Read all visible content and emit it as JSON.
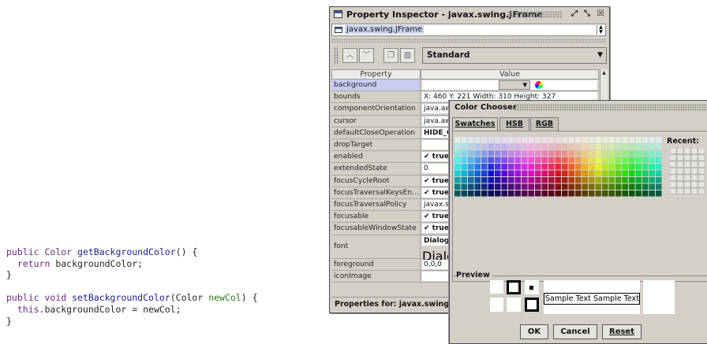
{
  "code": {
    "lines": [
      [
        {
          "t": "public ",
          "c": "kw"
        },
        {
          "t": "Color ",
          "c": "ty"
        },
        {
          "t": "getBackgroundColor",
          "c": "nm"
        },
        {
          "t": "() {",
          "c": ""
        }
      ],
      [
        {
          "t": "  return ",
          "c": "kw"
        },
        {
          "t": "backgroundColor;",
          "c": ""
        }
      ],
      [
        {
          "t": "}",
          "c": ""
        }
      ],
      [
        {
          "t": "",
          "c": ""
        }
      ],
      [
        {
          "t": "public ",
          "c": "kw"
        },
        {
          "t": "void ",
          "c": "kw"
        },
        {
          "t": "setBackgroundColor",
          "c": "nm"
        },
        {
          "t": "(Color ",
          "c": ""
        },
        {
          "t": "newCol",
          "c": "pm"
        },
        {
          "t": ") {",
          "c": ""
        }
      ],
      [
        {
          "t": "  this",
          "c": "kw"
        },
        {
          "t": ".backgroundColor = newCol;",
          "c": ""
        }
      ],
      [
        {
          "t": "}",
          "c": ""
        }
      ]
    ]
  },
  "inspector": {
    "title": "Property Inspector - javax.swing.JFrame",
    "title_buttons": [
      "⤢",
      "⤡",
      "☒"
    ],
    "class_field": "javax.swing.JFrame",
    "view_combo": "Standard",
    "col_property": "Property",
    "col_value": "Value",
    "rows": [
      {
        "name": "background",
        "value": ""
      },
      {
        "name": "bounds",
        "value": "X: 460  Y: 221  Width: 310  Height: 327"
      },
      {
        "name": "componentOrientation",
        "value": "java.aw"
      },
      {
        "name": "cursor",
        "value": "java.aw"
      },
      {
        "name": "defaultCloseOperation",
        "value": "HIDE_O"
      },
      {
        "name": "dropTarget",
        "value": ""
      },
      {
        "name": "enabled",
        "value": "✔ true"
      },
      {
        "name": "extendedState",
        "value": "0"
      },
      {
        "name": "focusCycleRoot",
        "value": "✔ true"
      },
      {
        "name": "focusTraversalKeysEn...",
        "value": "✔ true"
      },
      {
        "name": "focusTraversalPolicy",
        "value": "javax.s"
      },
      {
        "name": "focusable",
        "value": "✔ true"
      },
      {
        "name": "focusableWindowState",
        "value": "✔ true"
      },
      {
        "name": "font",
        "value": "Dialog"
      },
      {
        "name": "",
        "value": "Dialog,"
      },
      {
        "name": "foreground",
        "value": "0,0,0"
      },
      {
        "name": "iconImage",
        "value": ""
      }
    ],
    "footer": "Properties for:  javax.swing.JFra"
  },
  "chooser": {
    "title": "Color Chooser",
    "tabs": [
      "Swatches",
      "HSB",
      "RGB"
    ],
    "recent_label": "Recent:",
    "preview_label": "Preview",
    "sample_text": "Sample Text",
    "buttons": {
      "ok": "OK",
      "cancel": "Cancel",
      "reset": "Reset"
    }
  },
  "colors": {
    "window_bg": "#d4d0c8",
    "selection": "#c9ccef"
  }
}
